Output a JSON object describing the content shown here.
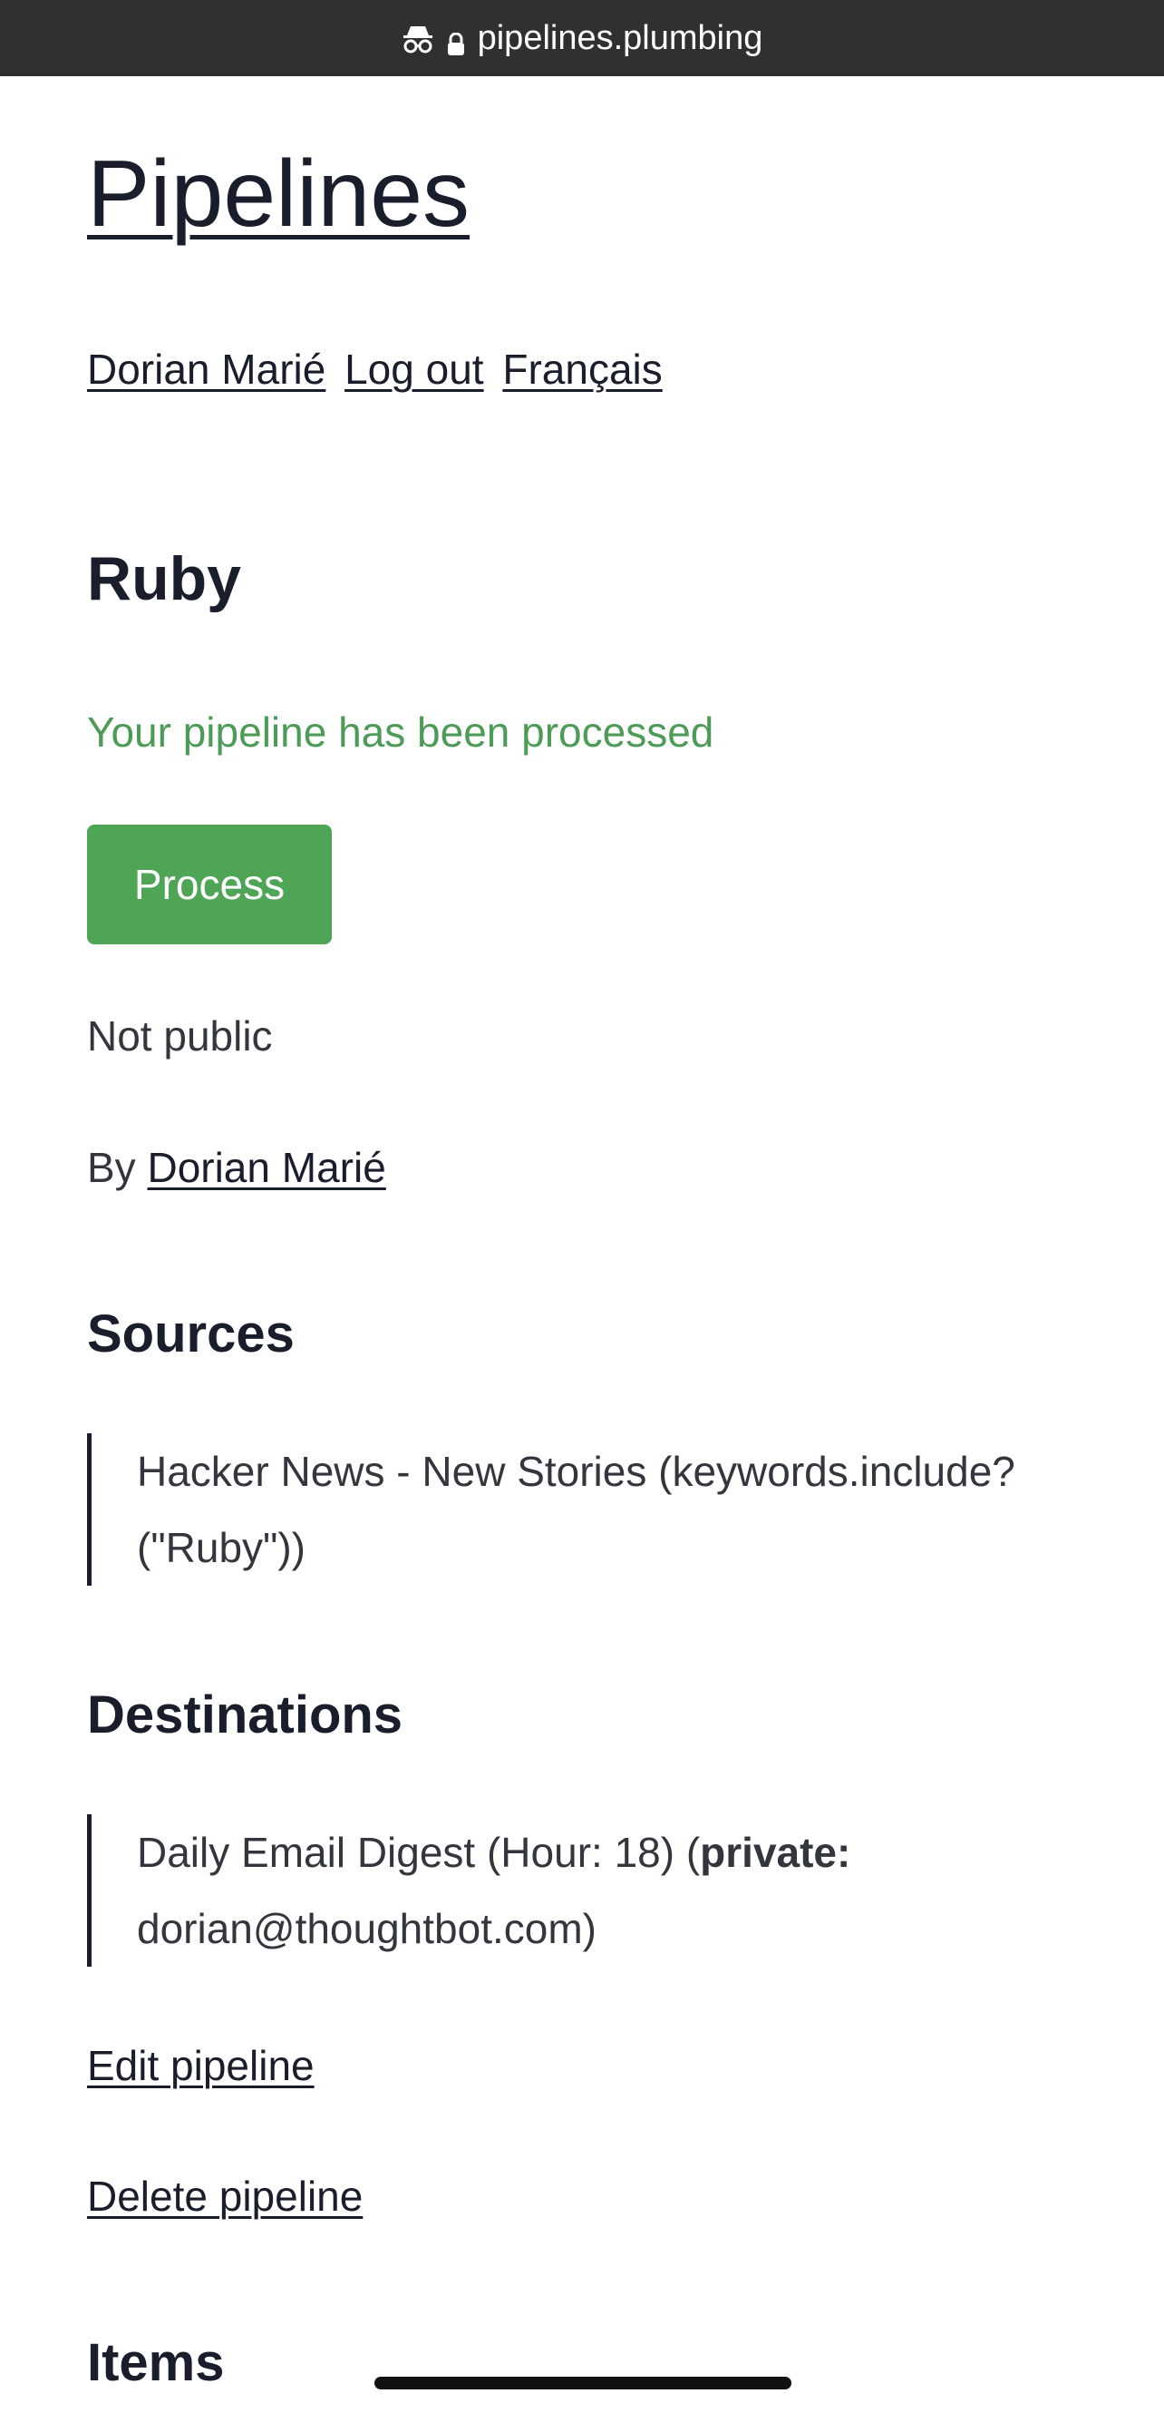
{
  "browser": {
    "url": "pipelines.plumbing"
  },
  "site": {
    "title": "Pipelines"
  },
  "nav": {
    "user": "Dorian Marié",
    "logout": "Log out",
    "language": "Français"
  },
  "pipeline": {
    "title": "Ruby",
    "flash": "Your pipeline has been processed",
    "process_label": "Process",
    "visibility": "Not public",
    "by_label": "By",
    "author": "Dorian Marié"
  },
  "sources": {
    "title": "Sources",
    "items": [
      "Hacker News - New Stories (keywords.include?(\"Ruby\"))"
    ]
  },
  "destinations": {
    "title": "Destinations",
    "items": [
      {
        "text": "Daily Email Digest (Hour: 18) (",
        "bold": "private:",
        "rest": " dorian@thoughtbot.com)"
      }
    ]
  },
  "actions": {
    "edit": "Edit pipeline",
    "delete": "Delete pipeline"
  },
  "items": {
    "title": "Items"
  },
  "colors": {
    "url_bar": "#2f3032",
    "flash": "#4c9b57",
    "process_button": "#4fa556",
    "text": "#1a1d2b"
  },
  "icons": {
    "incognito": "incognito-icon",
    "lock": "lock-icon"
  }
}
